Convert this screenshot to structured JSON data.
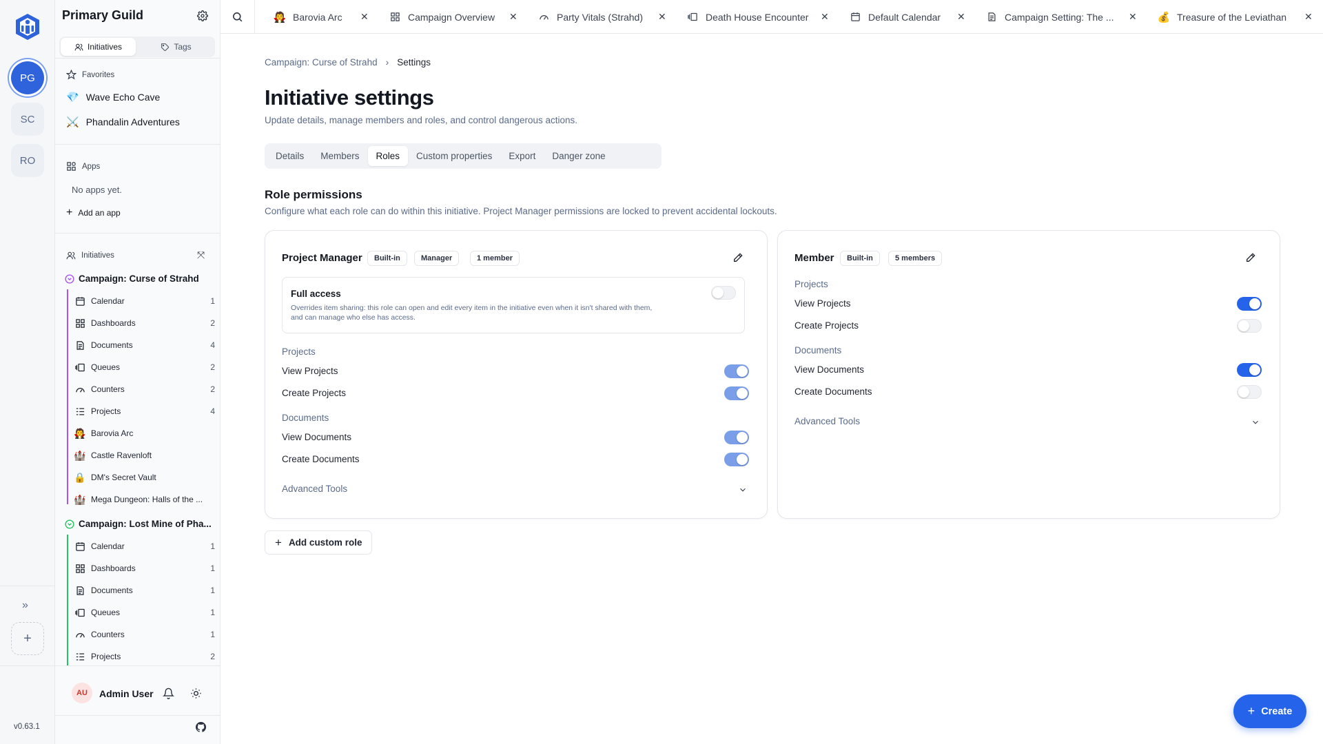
{
  "rail": {
    "workspaces": [
      "PG",
      "SC",
      "RO"
    ]
  },
  "sidebar": {
    "title": "Primary Guild",
    "seg_initiatives": "Initiatives",
    "seg_tags": "Tags",
    "favorites_label": "Favorites",
    "favorites": [
      "Wave Echo Cave",
      "Phandalin Adventures"
    ],
    "apps_label": "Apps",
    "no_apps": "No apps yet.",
    "add_app": "Add an app",
    "initiatives_label": "Initiatives",
    "campaigns": [
      {
        "name": "Campaign: Curse of Strahd",
        "color": "#a855f7",
        "items": [
          {
            "label": "Calendar",
            "count": "1"
          },
          {
            "label": "Dashboards",
            "count": "2"
          },
          {
            "label": "Documents",
            "count": "4"
          },
          {
            "label": "Queues",
            "count": "2"
          },
          {
            "label": "Counters",
            "count": "2"
          },
          {
            "label": "Projects",
            "count": "4"
          }
        ],
        "projects": [
          "Barovia Arc",
          "Castle Ravenloft",
          "DM's Secret Vault",
          "Mega Dungeon: Halls of the ..."
        ]
      },
      {
        "name": "Campaign: Lost Mine of Pha...",
        "color": "#22c55e",
        "items": [
          {
            "label": "Calendar",
            "count": "1"
          },
          {
            "label": "Dashboards",
            "count": "1"
          },
          {
            "label": "Documents",
            "count": "1"
          },
          {
            "label": "Queues",
            "count": "1"
          },
          {
            "label": "Counters",
            "count": "1"
          },
          {
            "label": "Projects",
            "count": "2"
          }
        ]
      }
    ],
    "user_initials": "AU",
    "user_name": "Admin User",
    "version": "v0.63.1"
  },
  "tabs": [
    "Barovia Arc",
    "Campaign Overview",
    "Party Vitals (Strahd)",
    "Death House Encounter",
    "Default Calendar",
    "Campaign Setting: The ...",
    "Treasure of the Leviathan"
  ],
  "main": {
    "breadcrumb_parent": "Campaign: Curse of Strahd",
    "breadcrumb_current": "Settings",
    "title": "Initiative settings",
    "subtitle": "Update details, manage members and roles, and control dangerous actions.",
    "settings_tabs": [
      "Details",
      "Members",
      "Roles",
      "Custom properties",
      "Export",
      "Danger zone"
    ],
    "active_tab": "Roles",
    "section_title": "Role permissions",
    "section_subtitle": "Configure what each role can do within this initiative. Project Manager permissions are locked to prevent accidental lockouts.",
    "pm_card": {
      "name": "Project Manager",
      "badges": [
        "Built-in",
        "Manager",
        "1 member"
      ],
      "full_access_title": "Full access",
      "full_access_desc_1": "Overrides item sharing: this role can open and edit every item in the initiative even when it isn't shared with them,",
      "full_access_desc_2": "and can manage who else has access.",
      "full_access_on": false,
      "group_projects": "Projects",
      "view_projects": "View Projects",
      "create_projects": "Create Projects",
      "group_documents": "Documents",
      "view_documents": "View Documents",
      "create_documents": "Create Documents",
      "advanced": "Advanced Tools"
    },
    "member_card": {
      "name": "Member",
      "badges": [
        "Built-in",
        "5 members"
      ],
      "group_projects": "Projects",
      "view_projects": "View Projects",
      "create_projects": "Create Projects",
      "group_documents": "Documents",
      "view_documents": "View Documents",
      "create_documents": "Create Documents",
      "advanced": "Advanced Tools"
    },
    "add_custom_role": "Add custom role",
    "create_button": "Create"
  },
  "colors": {
    "accent": "#2563eb",
    "toggle_disabled_on": "#7b9ee9"
  }
}
